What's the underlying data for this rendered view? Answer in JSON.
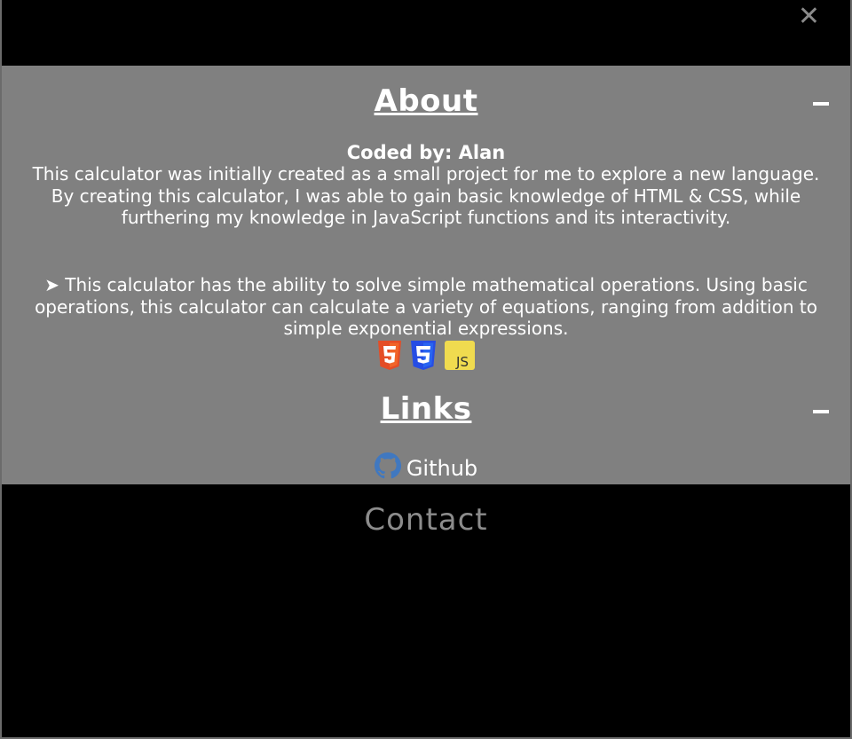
{
  "menu": {
    "close_icon": "close-icon",
    "close_glyph": "✕"
  },
  "about": {
    "title": "About",
    "coded_by": "Coded by: Alan",
    "paragraph1": "This calculator was initially created as a small project for me to explore a new language. By creating this calculator, I was able to gain basic knowledge of HTML & CSS, while furthering my knowledge in JavaScript functions and its interactivity.",
    "paragraph2": "➤ This calculator has the ability to solve simple mathematical operations. Using basic operations, this calculator can calculate a variety of equations, ranging from addition to simple exponential expressions.",
    "tech_icons": [
      "html5-icon",
      "css3-icon",
      "javascript-icon"
    ],
    "js_label": "JS"
  },
  "links": {
    "title": "Links",
    "github_label": "Github"
  },
  "contact": {
    "label": "Contact"
  },
  "colors": {
    "background": "#000000",
    "panel": "#808080",
    "html5": "#e44d26",
    "css3": "#264de4",
    "javascript": "#f0db4f",
    "github": "#4078c0"
  }
}
